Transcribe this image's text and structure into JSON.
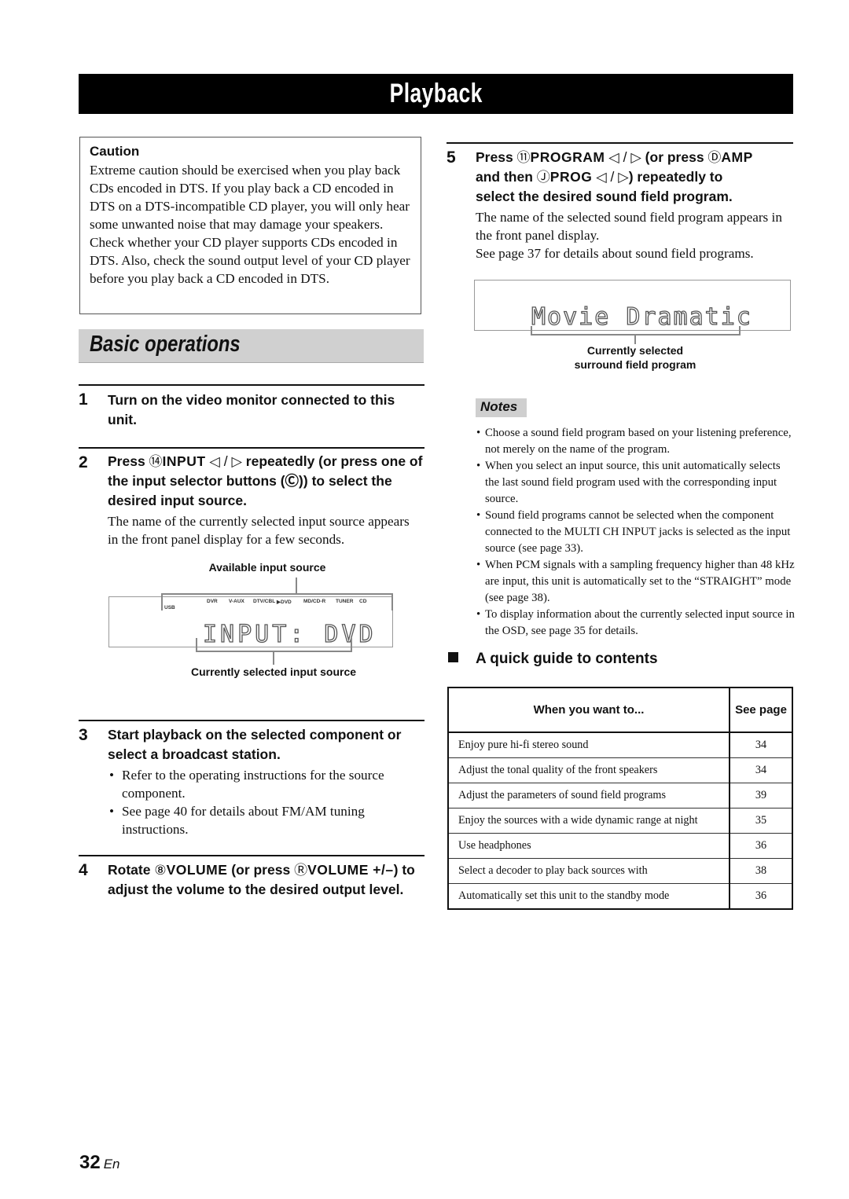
{
  "page_title": "Playback",
  "caution": {
    "title": "Caution",
    "text": "Extreme caution should be exercised when you play back CDs encoded in DTS. If you play back a CD encoded in DTS on a DTS-incompatible CD player, you will only hear some unwanted noise that may damage your speakers. Check whether your CD player supports CDs encoded in DTS. Also, check the sound output level of your CD player before you play back a CD encoded in DTS."
  },
  "section_title": "Basic operations",
  "steps": [
    {
      "num": "1",
      "text": "Turn on the video monitor connected to this unit."
    },
    {
      "num": "2",
      "parts": {
        "press": "Press ",
        "circ": "⑭",
        "key": "INPUT",
        "arrows": " ◁ / ▷ ",
        "rest": "repeatedly (or press one of the input selector buttons (Ⓒ)) to select the desired input source."
      },
      "body": "The name of the currently selected input source appears in the front panel display for a few seconds."
    },
    {
      "num": "3",
      "text": "Start playback on the selected component or select a broadcast station.",
      "bullets": [
        "Refer to the operating instructions for the source component.",
        "See page 40 for details about FM/AM tuning instructions."
      ]
    },
    {
      "num": "4",
      "parts": {
        "rotate": "Rotate ",
        "circ1": "⑧",
        "key1": "VOLUME",
        "mid": " (or press ",
        "circ2": "Ⓡ",
        "key2": "VOLUME +/–",
        "end": ")",
        "rest": "to adjust the volume to the desired output level."
      }
    },
    {
      "num": "5",
      "parts": {
        "press": "Press ",
        "circ1": "⑪",
        "key1": "PROGRAM",
        "arrows1": " ◁ / ▷ ",
        "mid": "(or press ",
        "circ2": "Ⓓ",
        "key2": "AMP",
        "and": "and then ",
        "circ3": "Ⓙ",
        "key3": "PROG",
        "arrows2": " ◁ / ▷",
        "rest1": ") repeatedly to",
        "rest2": "select the desired sound field program."
      },
      "body": [
        "The name of the selected sound field program appears in the front panel display.",
        "See page 37 for details about sound field programs."
      ]
    }
  ],
  "input_display": {
    "label_top": "Available input source",
    "sources": [
      "USB",
      "DVR",
      "V-AUX",
      "DTV/CBL",
      "▶DVD",
      "MD/CD-R",
      "TUNER",
      "CD"
    ],
    "lcd_text": "INPUT: DVD",
    "label_bottom": "Currently selected input source"
  },
  "program_display": {
    "lcd_text": "Movie Dramatic",
    "label_line1": "Currently selected",
    "label_line2": "surround field program"
  },
  "notes": {
    "title": "Notes",
    "items": [
      "Choose a sound field program based on your listening preference, not merely on the name of the program.",
      "When you select an input source, this unit automatically selects the last sound field program used with the corresponding input source.",
      "Sound field programs cannot be selected when the component connected to the MULTI CH INPUT jacks is selected as the input source (see page 33).",
      "When PCM signals with a sampling frequency higher than 48 kHz are input, this unit is automatically set to the “STRAIGHT” mode (see page 38).",
      "To display information about the currently selected input source in the OSD, see page 35 for details."
    ]
  },
  "guide": {
    "title": "A quick guide to contents",
    "columns": [
      "When you want to...",
      "See page"
    ],
    "rows": [
      [
        "Enjoy pure hi-fi stereo sound",
        "34"
      ],
      [
        "Adjust the tonal quality of the front speakers",
        "34"
      ],
      [
        "Adjust the parameters of sound field programs",
        "39"
      ],
      [
        "Enjoy the sources with a wide dynamic range at night",
        "35"
      ],
      [
        "Use headphones",
        "36"
      ],
      [
        "Select a decoder to play back sources with",
        "38"
      ],
      [
        "Automatically set this unit to the standby mode",
        "36"
      ]
    ]
  },
  "footer": {
    "page_number": "32",
    "language": "En"
  }
}
